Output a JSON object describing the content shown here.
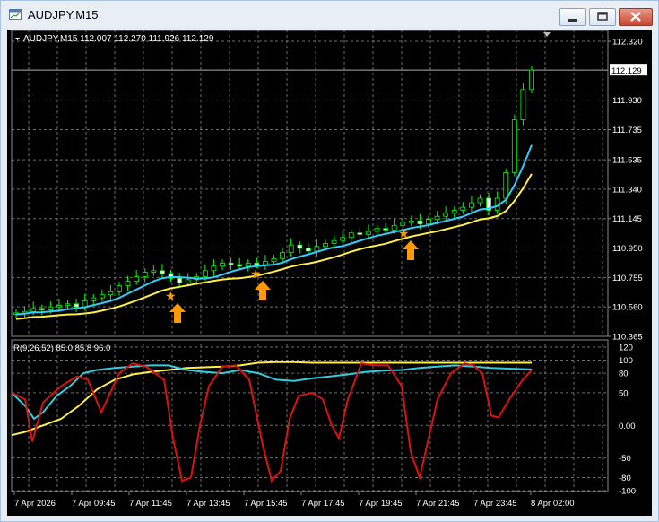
{
  "window": {
    "title": "AUDJPY,M15",
    "buttons": [
      "minimize",
      "restore",
      "close"
    ]
  },
  "chart_header": {
    "symbol_line": "AUDJPY,M15  112.007 112.270 111.926 112.129"
  },
  "price_axis": {
    "ticks": [
      "112.320",
      "112.129",
      "111.930",
      "111.735",
      "111.535",
      "111.340",
      "111.145",
      "110.950",
      "110.755",
      "110.560",
      "110.365"
    ],
    "current_price": "112.129"
  },
  "indicator": {
    "label": "R(9,26,52) 85.0 85.8 96.0",
    "ticks": [
      "120",
      "100",
      "80",
      "50",
      "0.00",
      "-50",
      "-80",
      "-100"
    ]
  },
  "time_axis": {
    "labels": [
      "7 Apr 2026",
      "7 Apr 09:45",
      "7 Apr 11:45",
      "7 Apr 13:45",
      "7 Apr 15:45",
      "7 Apr 17:45",
      "7 Apr 19:45",
      "7 Apr 21:45",
      "7 Apr 23:45",
      "8 Apr 02:00"
    ]
  },
  "colors": {
    "bull_candle": "#00ff00",
    "bear_candle": "#ffffff",
    "ma_fast": "#33ccff",
    "ma_slow": "#ffee44",
    "signal_arrow": "#ff9900",
    "rsi_fast": "#dd1111",
    "rsi_mid": "#33ccdd",
    "rsi_slow": "#ffee44",
    "grid": "#6e6e6e"
  },
  "chart_data": {
    "type": "candlestick",
    "symbol": "AUDJPY",
    "timeframe": "M15",
    "ylim": [
      110.365,
      112.4
    ],
    "closes": [
      110.52,
      110.53,
      110.55,
      110.54,
      110.56,
      110.57,
      110.58,
      110.56,
      110.6,
      110.62,
      110.64,
      110.66,
      110.7,
      110.73,
      110.76,
      110.79,
      110.8,
      110.78,
      110.75,
      110.72,
      110.74,
      110.76,
      110.8,
      110.83,
      110.85,
      110.84,
      110.83,
      110.85,
      110.84,
      110.86,
      110.88,
      110.92,
      110.97,
      110.95,
      110.93,
      110.96,
      110.98,
      111.0,
      111.02,
      111.05,
      111.04,
      111.06,
      111.08,
      111.07,
      111.1,
      111.12,
      111.13,
      111.11,
      111.14,
      111.16,
      111.18,
      111.2,
      111.22,
      111.25,
      111.28,
      111.2,
      111.28,
      111.45,
      111.8,
      112.0,
      112.129
    ],
    "signals": [
      "buy",
      "buy",
      "buy"
    ],
    "indicator": {
      "name": "R(9,26,52)",
      "values": [
        85.0,
        85.8,
        96.0
      ],
      "ylim": [
        -100,
        120
      ]
    }
  }
}
